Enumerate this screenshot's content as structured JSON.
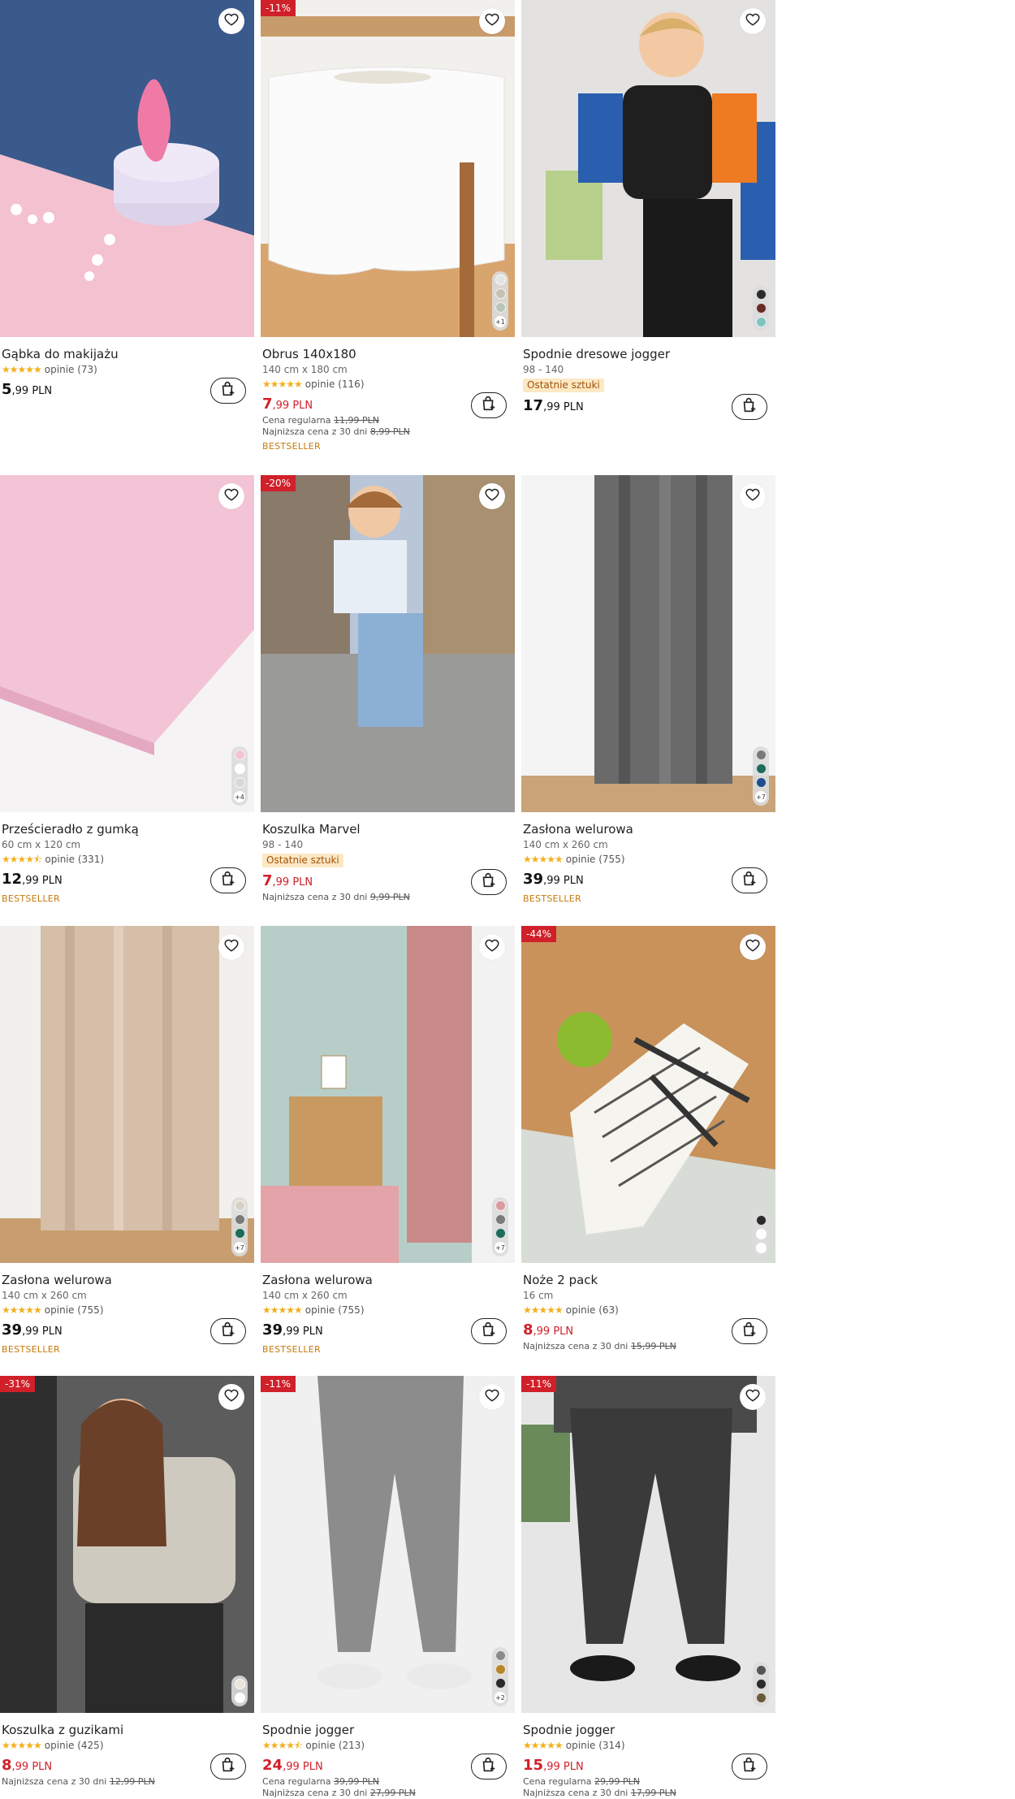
{
  "colors": {
    "sale": "#d0202a",
    "bestseller": "#c57a0c",
    "stars": "#f2b01e",
    "last_items_bg": "#fde8c4"
  },
  "products": [
    {
      "name": "Gąbka do makijażu",
      "size": "",
      "last_items": "",
      "rating_stars": 5,
      "reviews": "opinie (73)",
      "price_int": "5",
      "price_dec": ",99 PLN",
      "sale": false,
      "discount": "",
      "regular_price_label": "",
      "regular_price": "",
      "lowest_label": "",
      "lowest_price": "",
      "bestseller": "",
      "swatches": [],
      "more": ""
    },
    {
      "name": "Obrus 140x180",
      "size": "140 cm x 180 cm",
      "last_items": "",
      "rating_stars": 5,
      "reviews": "opinie (116)",
      "price_int": "7",
      "price_dec": ",99 PLN",
      "sale": true,
      "discount": "-11%",
      "regular_price_label": "Cena regularna",
      "regular_price": "11,99 PLN",
      "lowest_label": "Najniższa cena z 30 dni",
      "lowest_price": "8,99 PLN",
      "bestseller": "BESTSELLER",
      "swatches": [
        "#e4e4e4",
        "#c6c0b0",
        "#b8c4b8"
      ],
      "more": "+1"
    },
    {
      "name": "Spodnie dresowe jogger",
      "size": "98 - 140",
      "last_items": "Ostatnie sztuki",
      "rating_stars": 0,
      "reviews": "",
      "price_int": "17",
      "price_dec": ",99 PLN",
      "sale": false,
      "discount": "",
      "regular_price_label": "",
      "regular_price": "",
      "lowest_label": "",
      "lowest_price": "",
      "bestseller": "",
      "swatches": [
        "#2b2b2b",
        "#6a2a2a",
        "#7fc4c0"
      ],
      "more": ""
    },
    {
      "name": "Prześcieradło z gumką",
      "size": "60 cm x 120 cm",
      "last_items": "",
      "rating_stars": 4.5,
      "reviews": "opinie (331)",
      "price_int": "12",
      "price_dec": ",99 PLN",
      "sale": false,
      "discount": "",
      "regular_price_label": "",
      "regular_price": "",
      "lowest_label": "",
      "lowest_price": "",
      "bestseller": "BESTSELLER",
      "swatches": [
        "#f2c4d4",
        "#ffffff",
        "#d8d8d8"
      ],
      "more": "+4"
    },
    {
      "name": "Koszulka Marvel",
      "size": "98 - 140",
      "last_items": "Ostatnie sztuki",
      "rating_stars": 0,
      "reviews": "",
      "price_int": "7",
      "price_dec": ",99 PLN",
      "sale": true,
      "discount": "-20%",
      "regular_price_label": "",
      "regular_price": "",
      "lowest_label": "Najniższa cena z 30 dni",
      "lowest_price": "9,99 PLN",
      "bestseller": "",
      "swatches": [],
      "more": ""
    },
    {
      "name": "Zasłona welurowa",
      "size": "140 cm x 260 cm",
      "last_items": "",
      "rating_stars": 5,
      "reviews": "opinie (755)",
      "price_int": "39",
      "price_dec": ",99 PLN",
      "sale": false,
      "discount": "",
      "regular_price_label": "",
      "regular_price": "",
      "lowest_label": "",
      "lowest_price": "",
      "bestseller": "BESTSELLER",
      "swatches": [
        "#7a7a7a",
        "#1f6b5a",
        "#1e4f8a"
      ],
      "more": "+7"
    },
    {
      "name": "Zasłona welurowa",
      "size": "140 cm x 260 cm",
      "last_items": "",
      "rating_stars": 5,
      "reviews": "opinie (755)",
      "price_int": "39",
      "price_dec": ",99 PLN",
      "sale": false,
      "discount": "",
      "regular_price_label": "",
      "regular_price": "",
      "lowest_label": "",
      "lowest_price": "",
      "bestseller": "BESTSELLER",
      "swatches": [
        "#d8d2c6",
        "#7a7a7a",
        "#1f6b5a"
      ],
      "more": "+7"
    },
    {
      "name": "Zasłona welurowa",
      "size": "140 cm x 260 cm",
      "last_items": "",
      "rating_stars": 5,
      "reviews": "opinie (755)",
      "price_int": "39",
      "price_dec": ",99 PLN",
      "sale": false,
      "discount": "",
      "regular_price_label": "",
      "regular_price": "",
      "lowest_label": "",
      "lowest_price": "",
      "bestseller": "BESTSELLER",
      "swatches": [
        "#d99aa0",
        "#7a7a7a",
        "#1f6b5a"
      ],
      "more": "+7"
    },
    {
      "name": "Noże 2 pack",
      "size": "16 cm",
      "last_items": "",
      "rating_stars": 5,
      "reviews": "opinie (63)",
      "price_int": "8",
      "price_dec": ",99 PLN",
      "sale": true,
      "discount": "-44%",
      "regular_price_label": "",
      "regular_price": "",
      "lowest_label": "Najniższa cena z 30 dni",
      "lowest_price": "15,99 PLN",
      "bestseller": "",
      "swatches": [
        "#2b2b2b",
        "#ffffff",
        "#ffffff"
      ],
      "more": ""
    },
    {
      "name": "Koszulka z guzikami",
      "size": "",
      "last_items": "",
      "rating_stars": 5,
      "reviews": "opinie (425)",
      "price_int": "8",
      "price_dec": ",99 PLN",
      "sale": true,
      "discount": "-31%",
      "regular_price_label": "",
      "regular_price": "",
      "lowest_label": "Najniższa cena z 30 dni",
      "lowest_price": "12,99 PLN",
      "bestseller": "",
      "swatches": [
        "#e8e4dc",
        "#ffffff"
      ],
      "more": ""
    },
    {
      "name": "Spodnie jogger",
      "size": "",
      "last_items": "",
      "rating_stars": 4.5,
      "reviews": "opinie (213)",
      "price_int": "24",
      "price_dec": ",99 PLN",
      "sale": true,
      "discount": "-11%",
      "regular_price_label": "Cena regularna",
      "regular_price": "39,99 PLN",
      "lowest_label": "Najniższa cena z 30 dni",
      "lowest_price": "27,99 PLN",
      "bestseller": "",
      "swatches": [
        "#8a8a8a",
        "#b8862e",
        "#2b2b2b"
      ],
      "more": "+2"
    },
    {
      "name": "Spodnie jogger",
      "size": "",
      "last_items": "",
      "rating_stars": 5,
      "reviews": "opinie (314)",
      "price_int": "15",
      "price_dec": ",99 PLN",
      "sale": true,
      "discount": "-11%",
      "regular_price_label": "Cena regularna",
      "regular_price": "29,99 PLN",
      "lowest_label": "Najniższa cena z 30 dni",
      "lowest_price": "17,99 PLN",
      "bestseller": "",
      "swatches": [
        "#555555",
        "#2b2b2b",
        "#6b5a3a"
      ],
      "more": ""
    }
  ]
}
